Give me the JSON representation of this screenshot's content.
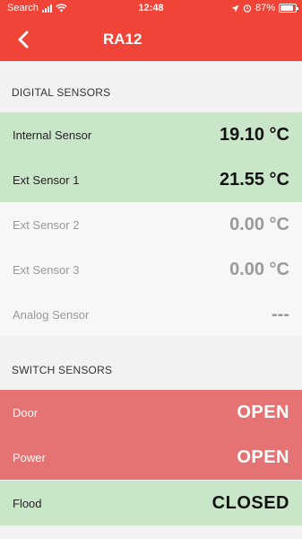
{
  "status_bar": {
    "carrier": "Search",
    "time": "12:48",
    "battery": "87%"
  },
  "nav": {
    "title": "RA12"
  },
  "digital_sensors": {
    "header": "DIGITAL SENSORS",
    "items": [
      {
        "label": "Internal Sensor",
        "value": "19.10 °C",
        "state": "active"
      },
      {
        "label": "Ext Sensor 1",
        "value": "21.55 °C",
        "state": "active"
      },
      {
        "label": "Ext Sensor 2",
        "value": "0.00 °C",
        "state": "inactive"
      },
      {
        "label": "Ext Sensor 3",
        "value": "0.00 °C",
        "state": "inactive"
      },
      {
        "label": "Analog Sensor",
        "value": "---",
        "state": "inactive"
      }
    ]
  },
  "switch_sensors": {
    "header": "SWITCH SENSORS",
    "items": [
      {
        "label": "Door",
        "value": "OPEN",
        "state": "alert"
      },
      {
        "label": "Power",
        "value": "OPEN",
        "state": "alert"
      },
      {
        "label": "Flood",
        "value": "CLOSED",
        "state": "ok"
      }
    ]
  },
  "colors": {
    "header_red": "#f04438",
    "active_green": "#c9e6c9",
    "alert_red": "#e57373",
    "inactive_gray": "#9a9a9a"
  }
}
